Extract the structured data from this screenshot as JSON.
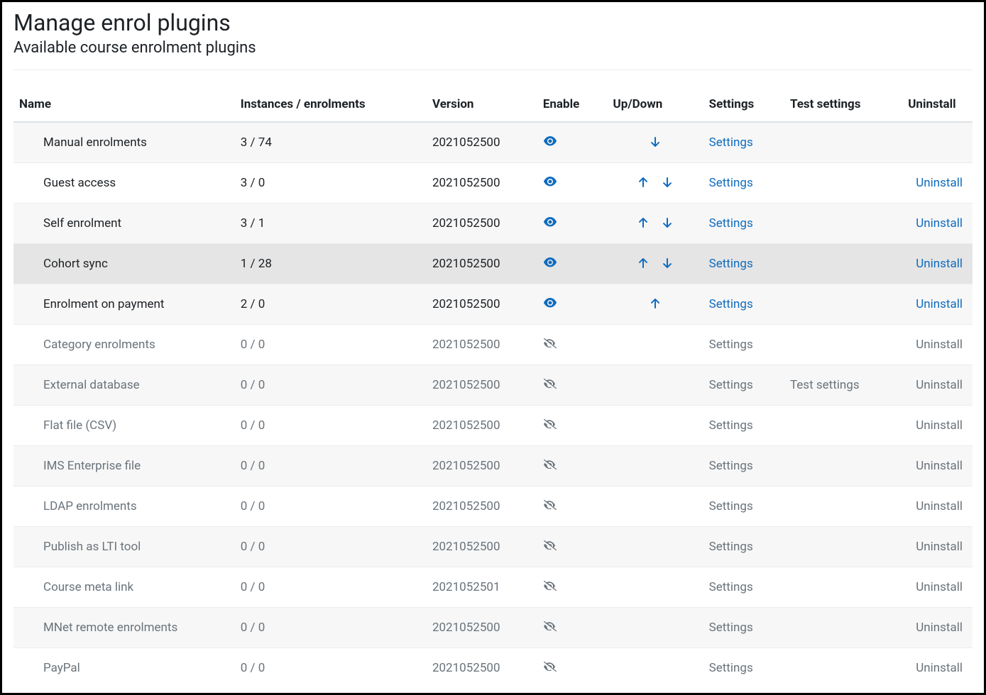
{
  "title": "Manage enrol plugins",
  "subtitle": "Available course enrolment plugins",
  "columns": {
    "name": "Name",
    "instances": "Instances / enrolments",
    "version": "Version",
    "enable": "Enable",
    "updown": "Up/Down",
    "settings": "Settings",
    "test": "Test settings",
    "uninstall": "Uninstall"
  },
  "labels": {
    "settings": "Settings",
    "test_settings": "Test settings",
    "uninstall": "Uninstall"
  },
  "colors": {
    "link": "#0f6cbf",
    "text": "#1d2125",
    "dimmed": "#6a737b",
    "stripe": "#f7f7f7",
    "hover": "#e5e5e5"
  },
  "rows": [
    {
      "name": "Manual enrolments",
      "instances": "3 / 74",
      "version": "2021052500",
      "enabled": true,
      "up": false,
      "down": true,
      "settings": true,
      "test": false,
      "uninstall": false,
      "hovered": false
    },
    {
      "name": "Guest access",
      "instances": "3 / 0",
      "version": "2021052500",
      "enabled": true,
      "up": true,
      "down": true,
      "settings": true,
      "test": false,
      "uninstall": true,
      "hovered": false
    },
    {
      "name": "Self enrolment",
      "instances": "3 / 1",
      "version": "2021052500",
      "enabled": true,
      "up": true,
      "down": true,
      "settings": true,
      "test": false,
      "uninstall": true,
      "hovered": false
    },
    {
      "name": "Cohort sync",
      "instances": "1 / 28",
      "version": "2021052500",
      "enabled": true,
      "up": true,
      "down": true,
      "settings": true,
      "test": false,
      "uninstall": true,
      "hovered": true
    },
    {
      "name": "Enrolment on payment",
      "instances": "2 / 0",
      "version": "2021052500",
      "enabled": true,
      "up": true,
      "down": false,
      "settings": true,
      "test": false,
      "uninstall": true,
      "hovered": false
    },
    {
      "name": "Category enrolments",
      "instances": "0 / 0",
      "version": "2021052500",
      "enabled": false,
      "up": false,
      "down": false,
      "settings": true,
      "test": false,
      "uninstall": true,
      "hovered": false
    },
    {
      "name": "External database",
      "instances": "0 / 0",
      "version": "2021052500",
      "enabled": false,
      "up": false,
      "down": false,
      "settings": true,
      "test": true,
      "uninstall": true,
      "hovered": false
    },
    {
      "name": "Flat file (CSV)",
      "instances": "0 / 0",
      "version": "2021052500",
      "enabled": false,
      "up": false,
      "down": false,
      "settings": true,
      "test": false,
      "uninstall": true,
      "hovered": false
    },
    {
      "name": "IMS Enterprise file",
      "instances": "0 / 0",
      "version": "2021052500",
      "enabled": false,
      "up": false,
      "down": false,
      "settings": true,
      "test": false,
      "uninstall": true,
      "hovered": false
    },
    {
      "name": "LDAP enrolments",
      "instances": "0 / 0",
      "version": "2021052500",
      "enabled": false,
      "up": false,
      "down": false,
      "settings": true,
      "test": false,
      "uninstall": true,
      "hovered": false
    },
    {
      "name": "Publish as LTI tool",
      "instances": "0 / 0",
      "version": "2021052500",
      "enabled": false,
      "up": false,
      "down": false,
      "settings": true,
      "test": false,
      "uninstall": true,
      "hovered": false
    },
    {
      "name": "Course meta link",
      "instances": "0 / 0",
      "version": "2021052501",
      "enabled": false,
      "up": false,
      "down": false,
      "settings": true,
      "test": false,
      "uninstall": true,
      "hovered": false
    },
    {
      "name": "MNet remote enrolments",
      "instances": "0 / 0",
      "version": "2021052500",
      "enabled": false,
      "up": false,
      "down": false,
      "settings": true,
      "test": false,
      "uninstall": true,
      "hovered": false
    },
    {
      "name": "PayPal",
      "instances": "0 / 0",
      "version": "2021052500",
      "enabled": false,
      "up": false,
      "down": false,
      "settings": true,
      "test": false,
      "uninstall": true,
      "hovered": false
    }
  ]
}
